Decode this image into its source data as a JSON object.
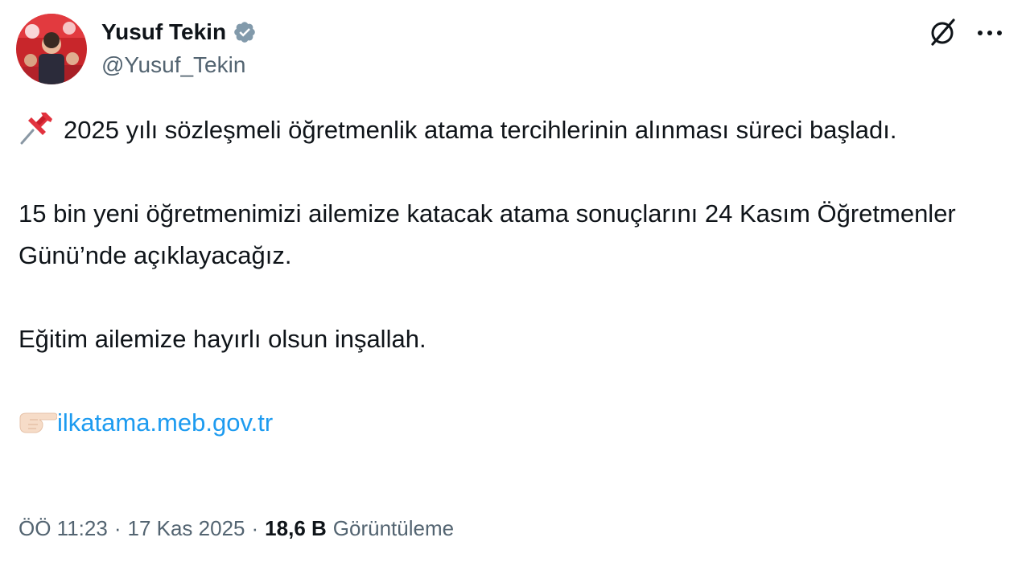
{
  "author": {
    "display_name": "Yusuf Tekin",
    "handle": "@Yusuf_Tekin",
    "verified_icon": "verified-badge-icon",
    "avatar_icon": "avatar-photo"
  },
  "header_actions": {
    "grok_icon": "grok-icon",
    "more_icon": "more-options-icon"
  },
  "tweet": {
    "line1_text": "2025 yılı sözleşmeli öğretmenlik atama tercihlerinin alınması süreci başladı.",
    "line2_text": "15 bin yeni öğretmenimizi ailemize katacak atama sonuçlarını 24 Kasım Öğretmenler Günü’nde açıklayacağız.",
    "line3_text": "Eğitim ailemize hayırlı olsun inşallah.",
    "link_text": "ilkatama.meb.gov.tr",
    "pin_emoji": "pushpin-emoji",
    "point_emoji": "pointing-right-emoji"
  },
  "meta": {
    "time": "ÖÖ 11:23",
    "date": "17 Kas 2025",
    "separator": "·",
    "views_count": "18,6 B",
    "views_label": "Görüntüleme"
  },
  "colors": {
    "text": "#0f1419",
    "muted": "#536471",
    "link": "#1d9bf0",
    "verified": "#829aab"
  }
}
